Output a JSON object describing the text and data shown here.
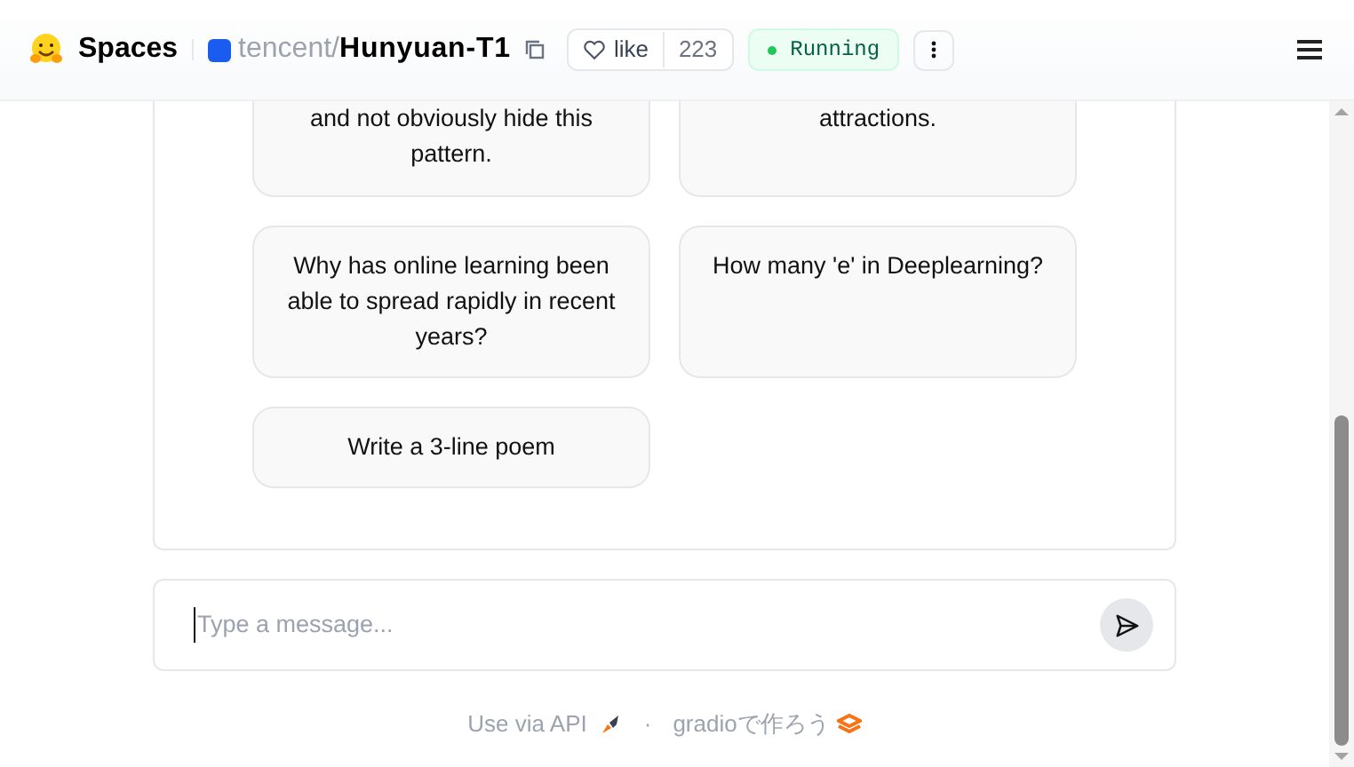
{
  "header": {
    "brand": "Spaces",
    "owner": "tencent",
    "separator": "/",
    "repo": "Hunyuan-T1",
    "like": {
      "label": "like",
      "count": "223"
    },
    "status": "Running"
  },
  "examples": [
    {
      "lines": [
        "and not obviously hide this",
        "pattern."
      ],
      "cut_top": true
    },
    {
      "lines": [
        "attractions."
      ],
      "cut_top": true
    },
    {
      "lines": [
        "Why has online learning been able to spread rapidly in recent years?"
      ],
      "cut_top": false
    },
    {
      "lines": [
        "How many 'e' in Deeplearning?"
      ],
      "cut_top": false
    },
    {
      "lines": [
        "Write a 3-line poem"
      ],
      "cut_top": false
    }
  ],
  "input": {
    "placeholder": "Type a message..."
  },
  "footer": {
    "api_link": "Use via API",
    "dot": "·",
    "built_with": "gradioで作ろう"
  }
}
